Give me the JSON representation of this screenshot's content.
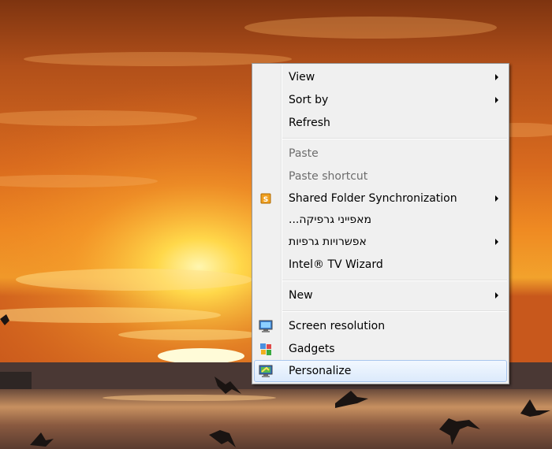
{
  "desktop": {
    "wallpaper": "sunset over sea with flying birds",
    "colors": {
      "sky_top": "#8a3a10",
      "sky_mid": "#e8701a",
      "sun": "#fff3a0",
      "sea": "#3a3230"
    }
  },
  "context_menu": {
    "colors": {
      "background": "#f0f0f0",
      "border": "#979797",
      "disabled_text": "#6d6d6d",
      "highlight_border": "#a8c6ee"
    },
    "items": [
      {
        "label": "View",
        "submenu": true,
        "enabled": true
      },
      {
        "label": "Sort by",
        "submenu": true,
        "enabled": true
      },
      {
        "label": "Refresh",
        "submenu": false,
        "enabled": true
      },
      {
        "label": "Paste",
        "submenu": false,
        "enabled": false
      },
      {
        "label": "Paste shortcut",
        "submenu": false,
        "enabled": false
      },
      {
        "label": "Shared Folder Synchronization",
        "submenu": true,
        "enabled": true,
        "icon": "shared-folder-sync-icon"
      },
      {
        "label": "מאפייני גרפיקה...",
        "submenu": false,
        "enabled": true
      },
      {
        "label": "אפשרויות גרפיות",
        "submenu": true,
        "enabled": true
      },
      {
        "label": "Intel® TV Wizard",
        "submenu": false,
        "enabled": true
      },
      {
        "label": "New",
        "submenu": true,
        "enabled": true
      },
      {
        "label": "Screen resolution",
        "submenu": false,
        "enabled": true,
        "icon": "monitor-icon"
      },
      {
        "label": "Gadgets",
        "submenu": false,
        "enabled": true,
        "icon": "gadgets-icon"
      },
      {
        "label": "Personalize",
        "submenu": false,
        "enabled": true,
        "highlighted": true,
        "icon": "personalize-icon"
      }
    ]
  }
}
